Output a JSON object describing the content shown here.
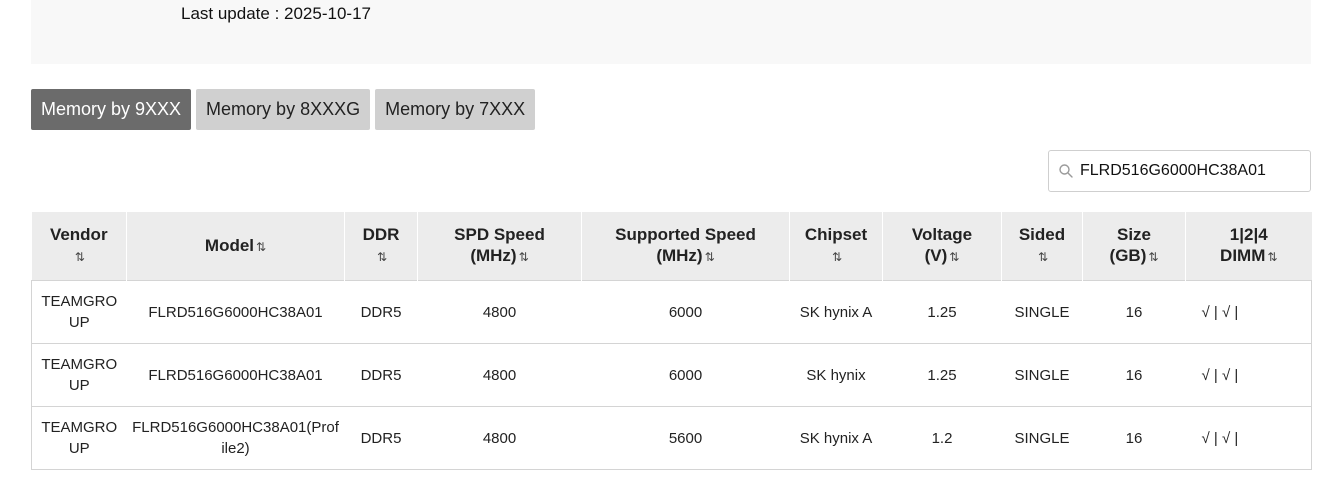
{
  "header": {
    "last_update": "Last update : 2025-10-17"
  },
  "tabs": [
    {
      "label": "Memory by 9XXX",
      "active": true
    },
    {
      "label": "Memory by 8XXXG",
      "active": false
    },
    {
      "label": "Memory by 7XXX",
      "active": false
    }
  ],
  "search": {
    "value": "FLRD516G6000HC38A01",
    "icon": "search-icon"
  },
  "table": {
    "sort_glyph": "⇅",
    "columns": [
      {
        "line1": "Vendor",
        "line2": ""
      },
      {
        "line1": "Model",
        "line2": ""
      },
      {
        "line1": "DDR",
        "line2": ""
      },
      {
        "line1": "SPD Speed",
        "line2": "(MHz)"
      },
      {
        "line1": "Supported Speed",
        "line2": "(MHz)"
      },
      {
        "line1": "Chipset",
        "line2": ""
      },
      {
        "line1": "Voltage",
        "line2": "(V)"
      },
      {
        "line1": "Sided",
        "line2": ""
      },
      {
        "line1": "Size",
        "line2": "(GB)"
      },
      {
        "line1": "1|2|4",
        "line2": "DIMM"
      }
    ],
    "rows": [
      [
        "TEAMGROUP",
        "FLRD516G6000HC38A01",
        "DDR5",
        "4800",
        "6000",
        "SK hynix A",
        "1.25",
        "SINGLE",
        "16",
        "√ | √ |"
      ],
      [
        "TEAMGROUP",
        "FLRD516G6000HC38A01",
        "DDR5",
        "4800",
        "6000",
        "SK hynix",
        "1.25",
        "SINGLE",
        "16",
        "√ | √ |"
      ],
      [
        "TEAMGROUP",
        "FLRD516G6000HC38A01(Profile2)",
        "DDR5",
        "4800",
        "5600",
        "SK hynix A",
        "1.2",
        "SINGLE",
        "16",
        "√ | √ |"
      ]
    ]
  }
}
